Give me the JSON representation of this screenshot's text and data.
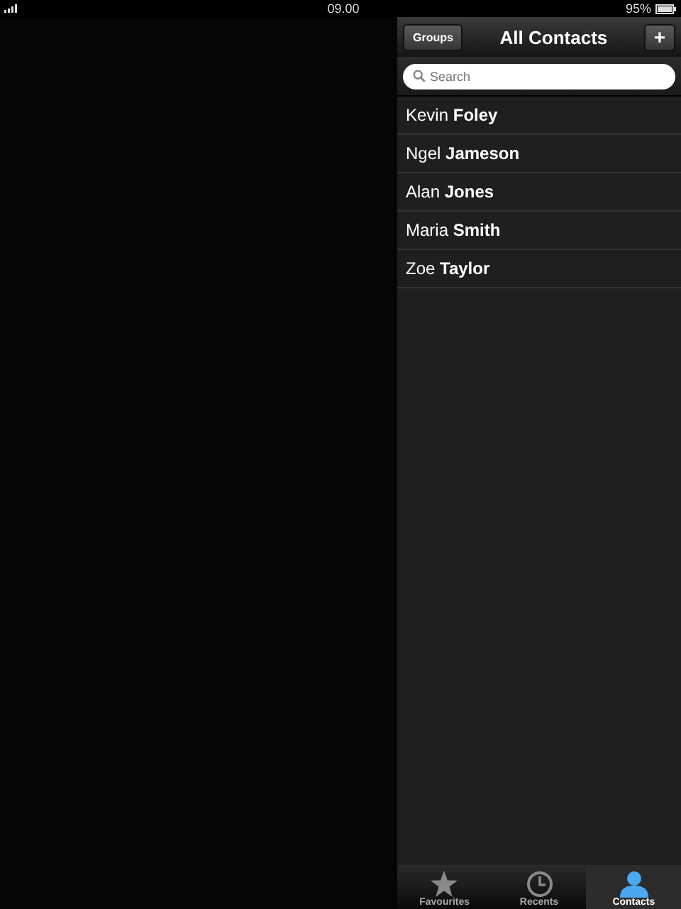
{
  "status_bar": {
    "time": "09.00",
    "battery": "95%"
  },
  "nav_bar": {
    "left_button": "Groups",
    "title": "All Contacts",
    "right_button": "+"
  },
  "search": {
    "placeholder": "Search"
  },
  "contacts": [
    {
      "name": "Kevin **Foley**"
    },
    {
      "name": "Ngel **Jameson**"
    },
    {
      "name": "Alan **Jones**"
    },
    {
      "name": "Maria **Smith**"
    },
    {
      "name": "Zoe **Taylor**"
    }
  ],
  "tabs": [
    {
      "label": "Favourites",
      "kind": "star",
      "selected": false
    },
    {
      "label": "Recents",
      "kind": "clock",
      "selected": false
    },
    {
      "label": "Contacts",
      "kind": "person",
      "selected": true
    }
  ]
}
